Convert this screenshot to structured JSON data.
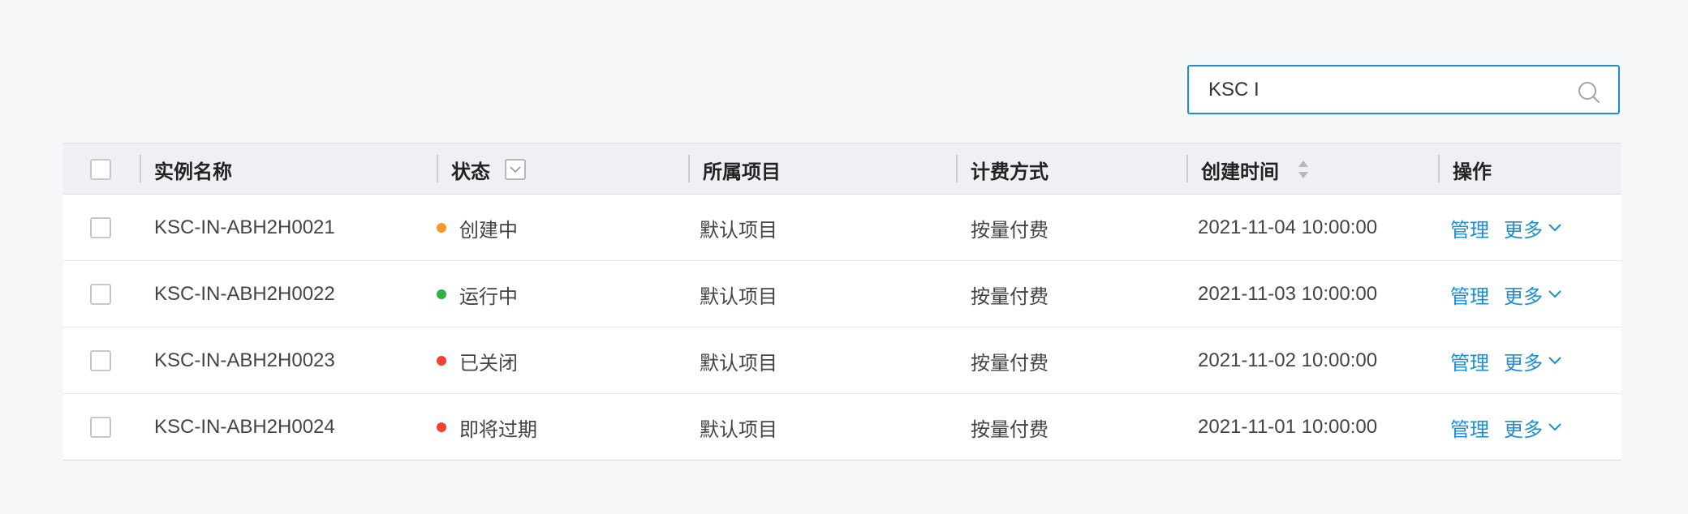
{
  "search": {
    "value": "KSC I",
    "placeholder": ""
  },
  "colors": {
    "accent": "#1a8fd6",
    "status_creating": "#f59a23",
    "status_running": "#2db245",
    "status_closed": "#f04134",
    "status_expiring": "#f04134"
  },
  "table": {
    "headers": {
      "name": "实例名称",
      "status": "状态",
      "project": "所属项目",
      "billing": "计费方式",
      "created": "创建时间",
      "actions": "操作"
    },
    "rows": [
      {
        "name": "KSC-IN-ABH2H0021",
        "status": "创建中",
        "status_color": "#f59a23",
        "project": "默认项目",
        "billing": "按量付费",
        "created": "2021-11-04 10:00:00",
        "manage": "管理",
        "more": "更多"
      },
      {
        "name": "KSC-IN-ABH2H0022",
        "status": "运行中",
        "status_color": "#2db245",
        "project": "默认项目",
        "billing": "按量付费",
        "created": "2021-11-03 10:00:00",
        "manage": "管理",
        "more": "更多"
      },
      {
        "name": "KSC-IN-ABH2H0023",
        "status": "已关闭",
        "status_color": "#f04134",
        "project": "默认项目",
        "billing": "按量付费",
        "created": "2021-11-02 10:00:00",
        "manage": "管理",
        "more": "更多"
      },
      {
        "name": "KSC-IN-ABH2H0024",
        "status": "即将过期",
        "status_color": "#f04134",
        "project": "默认项目",
        "billing": "按量付费",
        "created": "2021-11-01 10:00:00",
        "manage": "管理",
        "more": "更多"
      }
    ]
  }
}
